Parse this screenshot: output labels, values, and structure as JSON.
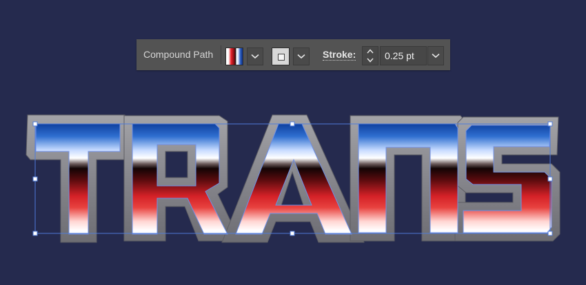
{
  "control_bar": {
    "selection_type": "Compound Path",
    "stroke_label": "Stroke:",
    "stroke_weight": "0.25 pt"
  },
  "artwork": {
    "text": "TRANS",
    "letters": [
      "T",
      "R",
      "A",
      "N",
      "S"
    ]
  },
  "colors": {
    "canvas_background": "#252a4e",
    "panel_background": "#535353",
    "selection_color": "#4f7bd9",
    "bevel_gray": "#8a8a8e",
    "gradient_top_blue": "#0b3fa0",
    "gradient_white": "#ffffff",
    "gradient_black": "#120404",
    "gradient_red": "#e0262c"
  },
  "icons": {
    "fill_dropdown": "chevron-down-icon",
    "stroke_dropdown": "chevron-down-icon",
    "spinner_up": "chevron-up-icon",
    "spinner_down": "chevron-down-icon",
    "weight_dropdown": "chevron-down-icon"
  }
}
